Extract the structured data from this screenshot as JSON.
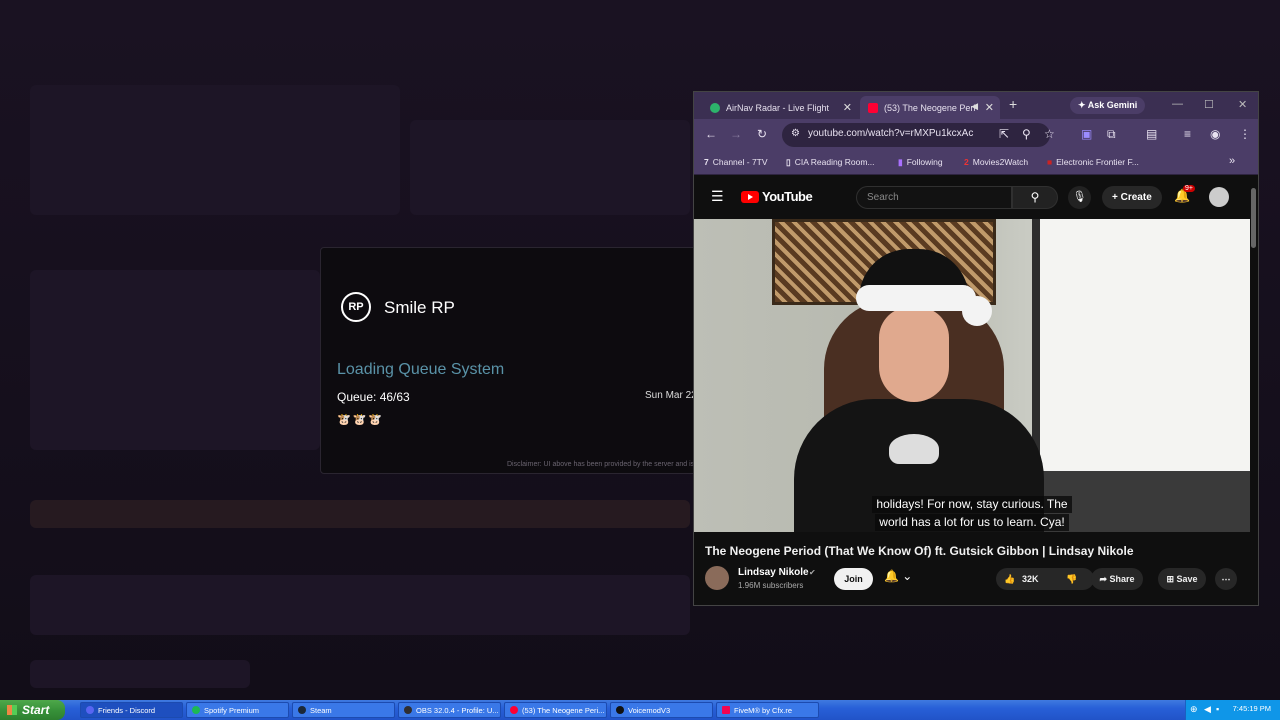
{
  "launcher": {
    "server_name": "Smile RP",
    "server_logo_text": "RP",
    "queue_heading": "Loading Queue System",
    "queue_count": "Queue: 46/63",
    "queue_emojis": "🐮🐮🐮",
    "queue_date": "Sun Mar 22",
    "disclaimer": "Disclaimer: UI above has been provided by the server and is"
  },
  "chrome": {
    "tabs": [
      {
        "label": "AirNav Radar - Live Flight",
        "favicon_color": "#2db36b"
      },
      {
        "label": "(53) The Neogene Peri",
        "favicon_color": "#ff0033"
      }
    ],
    "new_tab": "+",
    "ask_gemini": "Ask Gemini",
    "url": "youtube.com/watch?v=rMXPu1kcxAc",
    "bookmarks": [
      {
        "icon": "7",
        "label": "Channel - 7TV"
      },
      {
        "icon": "▯",
        "label": "CIA Reading Room..."
      },
      {
        "icon": "▮",
        "label": "Following"
      },
      {
        "icon": "2",
        "label": "Movies2Watch"
      },
      {
        "icon": "■",
        "label": "Electronic Frontier F..."
      }
    ],
    "bookmarks_more": "»"
  },
  "youtube": {
    "logo_text": "YouTube",
    "search_placeholder": "Search",
    "create_label": "Create",
    "notif_badge": "9+",
    "captions": [
      "holidays! For now, stay curious. The",
      "world has a lot for us to learn. Cya!"
    ],
    "video_title": "The Neogene Period (That We Know Of) ft. Gutsick Gibbon | Lindsay Nikole",
    "channel_name": "Lindsay Nikole",
    "subscribers": "1.96M subscribers",
    "join_label": "Join",
    "likes": "32K",
    "share_label": "Share",
    "save_label": "Save"
  },
  "taskbar": {
    "start_label": "Start",
    "items": [
      {
        "label": "Friends - Discord",
        "color": "#5865f2"
      },
      {
        "label": "Spotify Premium",
        "color": "#1db954"
      },
      {
        "label": "Steam",
        "color": "#1b2838"
      },
      {
        "label": "OBS 32.0.4 - Profile: U...",
        "color": "#302e31"
      },
      {
        "label": "(53) The Neogene Peri...",
        "color": "#ff0033"
      },
      {
        "label": "VoicemodV3",
        "color": "#111111"
      },
      {
        "label": "FiveM® by Cfx.re",
        "color": "#f40552"
      }
    ],
    "clock": "7:45:19 PM"
  }
}
